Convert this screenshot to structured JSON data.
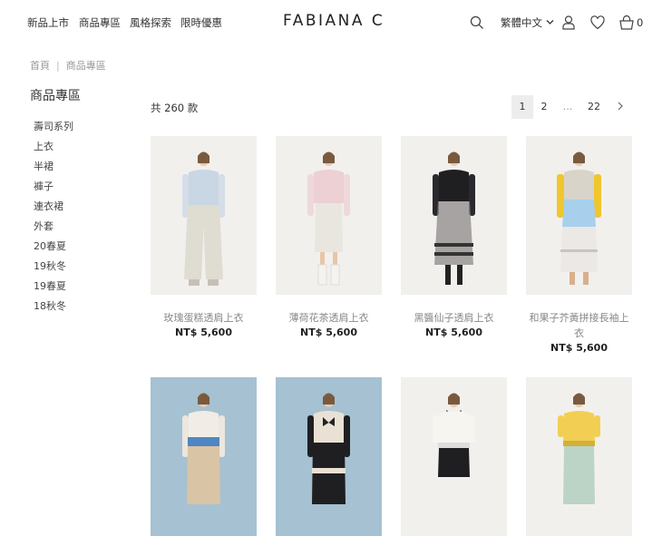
{
  "nav": {
    "items": [
      "新品上市",
      "商品專區",
      "風格探索",
      "限時優惠"
    ],
    "logo": "FABIANA C",
    "language": "繁體中文",
    "cart_count": "0"
  },
  "breadcrumb": [
    "首頁",
    "商品專區"
  ],
  "sidebar": {
    "title": "商品專區",
    "categories": [
      "壽司系列",
      "上衣",
      "半裙",
      "褲子",
      "連衣裙",
      "外套",
      "20春夏",
      "19秋冬",
      "19春夏",
      "18秋冬"
    ]
  },
  "listing": {
    "count_text": "共 260 款",
    "pagination": {
      "pages": [
        "1",
        "2",
        "…",
        "22"
      ],
      "current": "1"
    }
  },
  "products": [
    {
      "name": "玫瑰蛋糕透肩上衣",
      "price": "NT$ 5,600",
      "bg": "#f2f0ed"
    },
    {
      "name": "薄荷花茶透肩上衣",
      "price": "NT$ 5,600",
      "bg": "#f2f0ed"
    },
    {
      "name": "黑醬仙子透肩上衣",
      "price": "NT$ 5,600",
      "bg": "#f2f0ed"
    },
    {
      "name": "和果子芥黃拼接長袖上衣",
      "price": "NT$ 5,600",
      "bg": "#f2f0ed"
    },
    {
      "name": "",
      "price": "",
      "bg": "#a5c1d2"
    },
    {
      "name": "",
      "price": "",
      "bg": "#a5c1d2"
    },
    {
      "name": "",
      "price": "",
      "bg": "#f2f0ed"
    },
    {
      "name": "",
      "price": "",
      "bg": "#f2f0ed"
    }
  ],
  "icons": [
    "search-icon",
    "chevron-down-icon",
    "user-icon",
    "heart-icon",
    "cart-icon",
    "chevron-right-icon"
  ]
}
